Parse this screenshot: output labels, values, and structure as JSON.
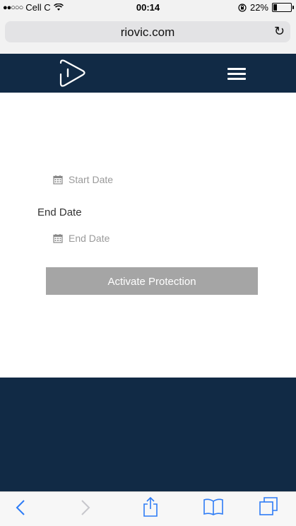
{
  "status_bar": {
    "signal": "●●○○○",
    "carrier": "Cell C",
    "time": "00:14",
    "battery_percent": "22%",
    "battery_level": 0.22
  },
  "browser": {
    "url": "riovic.com"
  },
  "form": {
    "start_date_placeholder": "Start Date",
    "end_date_label": "End Date",
    "end_date_placeholder": "End Date",
    "activate_button": "Activate Protection"
  },
  "colors": {
    "brand_navy": "#112a45",
    "button_gray": "#a5a5a5",
    "ios_blue": "#2d7cf6"
  },
  "icons": {
    "logo": "play-logo-icon",
    "menu": "hamburger-menu-icon",
    "calendar": "calendar-icon",
    "toolbar": [
      "back-icon",
      "forward-icon",
      "share-icon",
      "bookmarks-icon",
      "tabs-icon"
    ]
  }
}
